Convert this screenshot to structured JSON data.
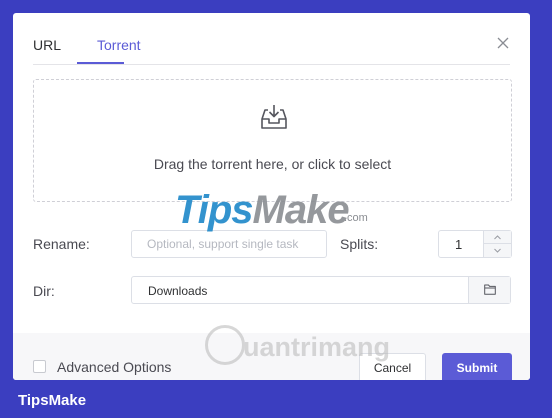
{
  "dialog": {
    "tabs": [
      {
        "label": "URL",
        "active": false
      },
      {
        "label": "Torrent",
        "active": true
      }
    ],
    "close_icon": "close-icon",
    "drop_zone": {
      "icon": "inbox-icon",
      "text": "Drag the torrent here, or click to select"
    },
    "rename": {
      "label": "Rename:",
      "value": "",
      "placeholder": "Optional, support single task"
    },
    "splits": {
      "label": "Splits:",
      "value": "1"
    },
    "dir": {
      "label": "Dir:",
      "value": "Downloads",
      "button_icon": "folder-icon"
    },
    "advanced": {
      "label": "Advanced Options",
      "checked": false
    },
    "buttons": {
      "cancel": "Cancel",
      "submit": "Submit"
    }
  },
  "watermarks": {
    "tipsmake_part1": "Tips",
    "tipsmake_part2": "Make",
    "tipsmake_suffix": ".com",
    "quantrimang": "uantrimang"
  },
  "footer": {
    "brand": "TipsMake"
  },
  "colors": {
    "accent": "#5b5bd6",
    "frame": "#3b3ec0",
    "text": "#4a4a52"
  }
}
